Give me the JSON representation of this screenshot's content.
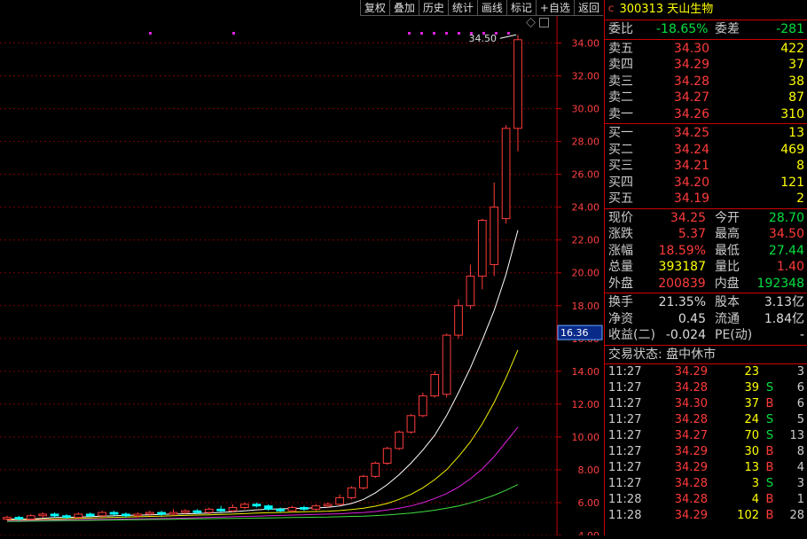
{
  "toolbar": {
    "items": [
      "复权",
      "叠加",
      "历史",
      "统计",
      "画线",
      "标记",
      "+自选",
      "返回"
    ]
  },
  "chart": {
    "max_label": "34.50",
    "current_price_tag": "16.36",
    "y_ticks": [
      "34.00",
      "32.00",
      "30.00",
      "28.00",
      "26.00",
      "24.00",
      "22.00",
      "20.00",
      "18.00",
      "16.00",
      "14.00",
      "12.00",
      "10.00",
      "8.00",
      "6.00",
      "4.00"
    ]
  },
  "chart_data": {
    "type": "candlestick",
    "ylim": [
      4,
      35.5
    ],
    "candles": [
      {
        "o": 5.0,
        "c": 5.1,
        "h": 5.2,
        "l": 4.9
      },
      {
        "o": 5.1,
        "c": 5.0,
        "h": 5.2,
        "l": 4.9
      },
      {
        "o": 5.0,
        "c": 5.2,
        "h": 5.3,
        "l": 4.95
      },
      {
        "o": 5.2,
        "c": 5.3,
        "h": 5.4,
        "l": 5.1
      },
      {
        "o": 5.3,
        "c": 5.2,
        "h": 5.4,
        "l": 5.1
      },
      {
        "o": 5.2,
        "c": 5.1,
        "h": 5.3,
        "l": 5.0
      },
      {
        "o": 5.1,
        "c": 5.3,
        "h": 5.4,
        "l": 5.05
      },
      {
        "o": 5.3,
        "c": 5.2,
        "h": 5.4,
        "l": 5.1
      },
      {
        "o": 5.2,
        "c": 5.4,
        "h": 5.5,
        "l": 5.1
      },
      {
        "o": 5.4,
        "c": 5.3,
        "h": 5.5,
        "l": 5.2
      },
      {
        "o": 5.3,
        "c": 5.2,
        "h": 5.4,
        "l": 5.1
      },
      {
        "o": 5.2,
        "c": 5.3,
        "h": 5.4,
        "l": 5.1
      },
      {
        "o": 5.3,
        "c": 5.4,
        "h": 5.5,
        "l": 5.2
      },
      {
        "o": 5.4,
        "c": 5.3,
        "h": 5.5,
        "l": 5.2
      },
      {
        "o": 5.3,
        "c": 5.4,
        "h": 5.6,
        "l": 5.2
      },
      {
        "o": 5.4,
        "c": 5.5,
        "h": 5.6,
        "l": 5.3
      },
      {
        "o": 5.5,
        "c": 5.4,
        "h": 5.6,
        "l": 5.3
      },
      {
        "o": 5.4,
        "c": 5.6,
        "h": 5.7,
        "l": 5.3
      },
      {
        "o": 5.6,
        "c": 5.5,
        "h": 5.8,
        "l": 5.4
      },
      {
        "o": 5.5,
        "c": 5.7,
        "h": 5.9,
        "l": 5.4
      },
      {
        "o": 5.7,
        "c": 5.9,
        "h": 6.0,
        "l": 5.6
      },
      {
        "o": 5.9,
        "c": 5.8,
        "h": 6.0,
        "l": 5.7
      },
      {
        "o": 5.8,
        "c": 5.6,
        "h": 5.9,
        "l": 5.5
      },
      {
        "o": 5.6,
        "c": 5.5,
        "h": 5.7,
        "l": 5.4
      },
      {
        "o": 5.5,
        "c": 5.7,
        "h": 5.8,
        "l": 5.4
      },
      {
        "o": 5.7,
        "c": 5.6,
        "h": 5.8,
        "l": 5.5
      },
      {
        "o": 5.6,
        "c": 5.8,
        "h": 5.9,
        "l": 5.5
      },
      {
        "o": 5.8,
        "c": 5.9,
        "h": 6.0,
        "l": 5.7
      },
      {
        "o": 5.9,
        "c": 6.3,
        "h": 6.5,
        "l": 5.8
      },
      {
        "o": 6.3,
        "c": 6.9,
        "h": 7.0,
        "l": 6.2
      },
      {
        "o": 6.9,
        "c": 7.6,
        "h": 7.7,
        "l": 6.8
      },
      {
        "o": 7.6,
        "c": 8.4,
        "h": 8.5,
        "l": 7.5
      },
      {
        "o": 8.4,
        "c": 9.3,
        "h": 9.4,
        "l": 8.3
      },
      {
        "o": 9.3,
        "c": 10.3,
        "h": 10.4,
        "l": 9.2
      },
      {
        "o": 10.3,
        "c": 11.3,
        "h": 11.4,
        "l": 10.2
      },
      {
        "o": 11.3,
        "c": 12.5,
        "h": 12.7,
        "l": 11.2
      },
      {
        "o": 12.5,
        "c": 13.8,
        "h": 14.0,
        "l": 12.4
      },
      {
        "o": 12.6,
        "c": 16.2,
        "h": 16.3,
        "l": 12.4
      },
      {
        "o": 16.2,
        "c": 18.0,
        "h": 18.4,
        "l": 16.0
      },
      {
        "o": 18.0,
        "c": 19.8,
        "h": 20.5,
        "l": 17.8
      },
      {
        "o": 19.8,
        "c": 23.2,
        "h": 23.3,
        "l": 19.0
      },
      {
        "o": 20.5,
        "c": 24.0,
        "h": 25.5,
        "l": 19.8
      },
      {
        "o": 23.3,
        "c": 28.8,
        "h": 29.0,
        "l": 23.0
      },
      {
        "o": 28.8,
        "c": 34.2,
        "h": 34.5,
        "l": 27.4
      }
    ],
    "ma": [
      {
        "name": "ma-white",
        "color": "#ffffff",
        "values": [
          5.0,
          5.0,
          5.0,
          5.05,
          5.1,
          5.1,
          5.12,
          5.15,
          5.18,
          5.2,
          5.22,
          5.24,
          5.26,
          5.28,
          5.3,
          5.32,
          5.34,
          5.36,
          5.4,
          5.44,
          5.5,
          5.56,
          5.6,
          5.62,
          5.64,
          5.66,
          5.68,
          5.72,
          5.8,
          5.95,
          6.2,
          6.6,
          7.1,
          7.7,
          8.4,
          9.2,
          10.1,
          11.3,
          12.7,
          14.2,
          15.9,
          17.7,
          19.9,
          22.6
        ]
      },
      {
        "name": "ma-yellow",
        "color": "#f0f000",
        "values": [
          4.95,
          4.96,
          4.97,
          4.98,
          5.0,
          5.02,
          5.04,
          5.06,
          5.08,
          5.1,
          5.12,
          5.14,
          5.16,
          5.18,
          5.2,
          5.22,
          5.24,
          5.26,
          5.28,
          5.3,
          5.33,
          5.36,
          5.38,
          5.4,
          5.42,
          5.44,
          5.46,
          5.48,
          5.52,
          5.58,
          5.66,
          5.78,
          5.95,
          6.2,
          6.5,
          6.9,
          7.4,
          8.0,
          8.8,
          9.7,
          10.8,
          12.1,
          13.6,
          15.3
        ]
      },
      {
        "name": "ma-magenta",
        "color": "#e020e0",
        "values": [
          4.9,
          4.91,
          4.92,
          4.93,
          4.94,
          4.95,
          4.96,
          4.97,
          4.98,
          4.99,
          5.0,
          5.01,
          5.02,
          5.03,
          5.04,
          5.06,
          5.08,
          5.1,
          5.12,
          5.14,
          5.16,
          5.18,
          5.2,
          5.22,
          5.24,
          5.26,
          5.28,
          5.3,
          5.32,
          5.36,
          5.4,
          5.46,
          5.55,
          5.66,
          5.8,
          6.0,
          6.25,
          6.55,
          6.95,
          7.45,
          8.05,
          8.8,
          9.7,
          10.6
        ]
      },
      {
        "name": "ma-green",
        "color": "#40e040",
        "values": [
          4.85,
          4.86,
          4.87,
          4.88,
          4.89,
          4.9,
          4.91,
          4.92,
          4.93,
          4.94,
          4.95,
          4.96,
          4.97,
          4.98,
          4.99,
          5.0,
          5.01,
          5.02,
          5.03,
          5.04,
          5.05,
          5.06,
          5.07,
          5.08,
          5.09,
          5.1,
          5.11,
          5.12,
          5.14,
          5.16,
          5.18,
          5.21,
          5.25,
          5.3,
          5.36,
          5.44,
          5.54,
          5.66,
          5.8,
          5.98,
          6.2,
          6.45,
          6.75,
          7.1
        ]
      }
    ]
  },
  "stock": {
    "code": "300313",
    "name": "天山生物",
    "marker": "C"
  },
  "committee": {
    "ratio_label": "委比",
    "ratio": "-18.65%",
    "diff_label": "委差",
    "diff": "-281"
  },
  "asks": [
    {
      "label": "卖五",
      "price": "34.30",
      "vol": "422"
    },
    {
      "label": "卖四",
      "price": "34.29",
      "vol": "37"
    },
    {
      "label": "卖三",
      "price": "34.28",
      "vol": "38"
    },
    {
      "label": "卖二",
      "price": "34.27",
      "vol": "87"
    },
    {
      "label": "卖一",
      "price": "34.26",
      "vol": "310"
    }
  ],
  "bids": [
    {
      "label": "买一",
      "price": "34.25",
      "vol": "13"
    },
    {
      "label": "买二",
      "price": "34.24",
      "vol": "469"
    },
    {
      "label": "买三",
      "price": "34.21",
      "vol": "8"
    },
    {
      "label": "买四",
      "price": "34.20",
      "vol": "121"
    },
    {
      "label": "买五",
      "price": "34.19",
      "vol": "2"
    }
  ],
  "quote": [
    {
      "k1": "现价",
      "v1": "34.25",
      "c1": "red",
      "k2": "今开",
      "v2": "28.70",
      "c2": "green"
    },
    {
      "k1": "涨跌",
      "v1": "5.37",
      "c1": "red",
      "k2": "最高",
      "v2": "34.50",
      "c2": "red"
    },
    {
      "k1": "涨幅",
      "v1": "18.59%",
      "c1": "red",
      "k2": "最低",
      "v2": "27.44",
      "c2": "green"
    },
    {
      "k1": "总量",
      "v1": "393187",
      "c1": "yellow",
      "k2": "量比",
      "v2": "1.40",
      "c2": "red"
    },
    {
      "k1": "外盘",
      "v1": "200839",
      "c1": "red",
      "k2": "内盘",
      "v2": "192348",
      "c2": "green"
    }
  ],
  "finance": [
    {
      "k1": "换手",
      "v1": "21.35%",
      "k2": "股本",
      "v2": "3.13亿"
    },
    {
      "k1": "净资",
      "v1": "0.45",
      "k2": "流通",
      "v2": "1.84亿"
    },
    {
      "k1": "收益(二)",
      "v1": "-0.024",
      "k2": "PE(动)",
      "v2": "-"
    }
  ],
  "status": "交易状态: 盘中休市",
  "ticks": [
    {
      "time": "11:27",
      "price": "34.29",
      "qty": "23",
      "dir": "",
      "n": "3"
    },
    {
      "time": "11:27",
      "price": "34.28",
      "qty": "39",
      "dir": "S",
      "n": "6"
    },
    {
      "time": "11:27",
      "price": "34.30",
      "qty": "37",
      "dir": "B",
      "n": "6"
    },
    {
      "time": "11:27",
      "price": "34.28",
      "qty": "24",
      "dir": "S",
      "n": "5"
    },
    {
      "time": "11:27",
      "price": "34.27",
      "qty": "70",
      "dir": "S",
      "n": "13"
    },
    {
      "time": "11:27",
      "price": "34.29",
      "qty": "30",
      "dir": "B",
      "n": "8"
    },
    {
      "time": "11:27",
      "price": "34.29",
      "qty": "13",
      "dir": "B",
      "n": "4"
    },
    {
      "time": "11:27",
      "price": "34.28",
      "qty": "3",
      "dir": "S",
      "n": "3"
    },
    {
      "time": "11:28",
      "price": "34.28",
      "qty": "4",
      "dir": "B",
      "n": "1"
    },
    {
      "time": "11:28",
      "price": "34.29",
      "qty": "102",
      "dir": "B",
      "n": "28"
    }
  ],
  "colors": {
    "up": "#ff3b3b",
    "down": "#00ffff",
    "grid": "#8b0000",
    "border": "#c00000"
  }
}
